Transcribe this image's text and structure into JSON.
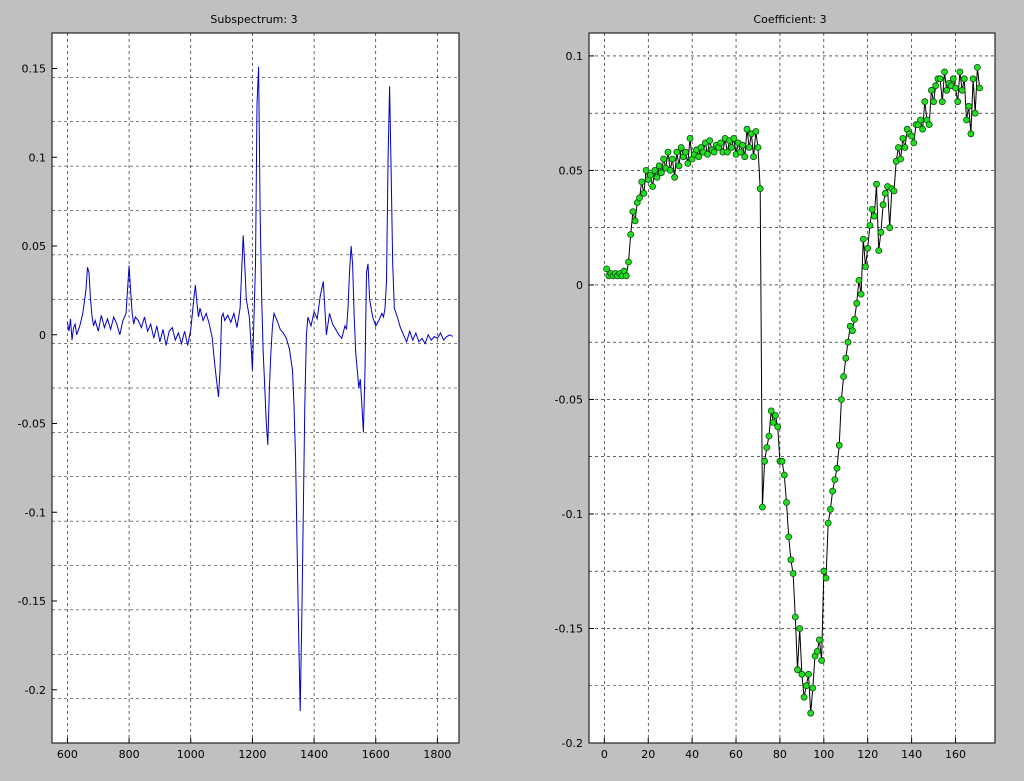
{
  "figure": {
    "background": "#c0c0c0"
  },
  "chart_data": [
    {
      "type": "line",
      "title": "Subspectrum: 3",
      "xlabel": "",
      "ylabel": "",
      "xlim": [
        550,
        1870
      ],
      "ylim": [
        -0.23,
        0.17
      ],
      "xticks": [
        600,
        800,
        1000,
        1200,
        1400,
        1600,
        1800
      ],
      "yticks": [
        -0.2,
        -0.15,
        -0.1,
        -0.05,
        0,
        0.05,
        0.1,
        0.15
      ],
      "xtick_labels": [
        "600",
        "800",
        "1000",
        "1200",
        "1400",
        "1600",
        "1800"
      ],
      "ytick_labels": [
        "-0.2",
        "-0.15",
        "-0.1",
        "-0.05",
        "0",
        "0.05",
        "0.1",
        "0.15"
      ],
      "grid": true,
      "line_color": "#0000c8",
      "series": [
        {
          "x": [
            600,
            605,
            610,
            615,
            620,
            625,
            630,
            640,
            650,
            660,
            665,
            670,
            675,
            680,
            685,
            690,
            700,
            710,
            720,
            730,
            740,
            750,
            760,
            770,
            780,
            790,
            795,
            800,
            805,
            810,
            815,
            820,
            830,
            840,
            850,
            860,
            870,
            880,
            890,
            900,
            910,
            920,
            930,
            940,
            950,
            960,
            970,
            980,
            990,
            1000,
            1010,
            1015,
            1020,
            1025,
            1030,
            1040,
            1050,
            1060,
            1070,
            1075,
            1080,
            1085,
            1090,
            1095,
            1100,
            1105,
            1110,
            1120,
            1130,
            1140,
            1150,
            1160,
            1165,
            1170,
            1175,
            1180,
            1185,
            1190,
            1195,
            1200,
            1205,
            1210,
            1215,
            1220,
            1225,
            1230,
            1235,
            1240,
            1245,
            1250,
            1255,
            1260,
            1265,
            1270,
            1275,
            1280,
            1290,
            1300,
            1310,
            1320,
            1330,
            1335,
            1340,
            1345,
            1350,
            1355,
            1360,
            1365,
            1370,
            1375,
            1380,
            1390,
            1400,
            1410,
            1420,
            1430,
            1440,
            1450,
            1460,
            1470,
            1480,
            1490,
            1500,
            1505,
            1510,
            1515,
            1520,
            1525,
            1530,
            1535,
            1540,
            1545,
            1550,
            1555,
            1560,
            1565,
            1570,
            1575,
            1580,
            1590,
            1600,
            1610,
            1620,
            1625,
            1630,
            1635,
            1640,
            1645,
            1650,
            1655,
            1660,
            1670,
            1680,
            1690,
            1700,
            1710,
            1720,
            1730,
            1740,
            1750,
            1760,
            1770,
            1780,
            1790,
            1800,
            1810,
            1820,
            1830,
            1840,
            1850
          ],
          "y": [
            0.007,
            0.002,
            0.009,
            -0.003,
            0.004,
            0.006,
            0.0,
            0.005,
            0.012,
            0.025,
            0.038,
            0.035,
            0.02,
            0.01,
            0.005,
            0.008,
            0.002,
            0.011,
            0.004,
            0.009,
            0.003,
            0.01,
            0.006,
            0.0,
            0.008,
            0.012,
            0.025,
            0.039,
            0.025,
            0.012,
            0.006,
            0.01,
            0.008,
            0.004,
            0.01,
            0.002,
            0.006,
            -0.002,
            0.005,
            -0.004,
            0.003,
            -0.006,
            0.002,
            0.004,
            -0.003,
            0.001,
            -0.005,
            0.002,
            -0.006,
            0.003,
            0.02,
            0.028,
            0.018,
            0.01,
            0.015,
            0.008,
            0.012,
            0.006,
            -0.002,
            -0.012,
            -0.02,
            -0.028,
            -0.035,
            -0.02,
            0.01,
            0.012,
            0.008,
            0.011,
            0.007,
            0.012,
            0.004,
            0.015,
            0.035,
            0.056,
            0.04,
            0.02,
            0.015,
            0.01,
            -0.004,
            -0.02,
            0.01,
            0.04,
            0.13,
            0.151,
            0.07,
            0.02,
            -0.01,
            -0.03,
            -0.05,
            -0.062,
            -0.03,
            -0.01,
            0.005,
            0.012,
            0.01,
            0.008,
            0.003,
            0.001,
            -0.002,
            -0.008,
            -0.02,
            -0.04,
            -0.07,
            -0.12,
            -0.17,
            -0.212,
            -0.16,
            -0.1,
            -0.04,
            0.0,
            0.01,
            0.005,
            0.013,
            0.009,
            0.022,
            0.03,
            0.0,
            0.012,
            0.006,
            0.003,
            0.0,
            -0.002,
            0.005,
            0.003,
            0.015,
            0.035,
            0.05,
            0.04,
            0.01,
            -0.01,
            -0.02,
            -0.03,
            -0.025,
            -0.04,
            -0.055,
            -0.02,
            0.035,
            0.04,
            0.02,
            0.01,
            0.005,
            0.008,
            0.012,
            0.01,
            0.015,
            0.03,
            0.1,
            0.14,
            0.09,
            0.04,
            0.015,
            0.01,
            0.004,
            0.0,
            -0.004,
            0.002,
            -0.003,
            0.001,
            -0.004,
            -0.002,
            -0.005,
            0.0,
            -0.003,
            -0.001,
            -0.002,
            0.001,
            -0.003,
            -0.001,
            0.0,
            -0.001
          ]
        }
      ]
    },
    {
      "type": "line",
      "title": "Coefficient: 3",
      "xlabel": "",
      "ylabel": "",
      "xlim": [
        -7,
        178
      ],
      "ylim": [
        -0.2,
        0.11
      ],
      "xticks": [
        0,
        20,
        40,
        60,
        80,
        100,
        120,
        140,
        160
      ],
      "yticks": [
        -0.2,
        -0.15,
        -0.1,
        -0.05,
        0,
        0.05,
        0.1
      ],
      "xtick_labels": [
        "0",
        "20",
        "40",
        "60",
        "80",
        "100",
        "120",
        "140",
        "160"
      ],
      "ytick_labels": [
        "-0.2",
        "-0.15",
        "-0.1",
        "-0.05",
        "0",
        "0.05",
        "0.1"
      ],
      "grid": true,
      "line_color": "#000000",
      "marker_fill": "#22dd22",
      "marker_edge": "#0a500a",
      "series": [
        {
          "x": [
            1,
            2,
            3,
            4,
            5,
            6,
            7,
            8,
            9,
            10,
            11,
            12,
            13,
            14,
            15,
            16,
            17,
            18,
            19,
            20,
            21,
            22,
            23,
            24,
            25,
            26,
            27,
            28,
            29,
            30,
            31,
            32,
            33,
            34,
            35,
            36,
            37,
            38,
            39,
            40,
            41,
            42,
            43,
            44,
            45,
            46,
            47,
            48,
            49,
            50,
            51,
            52,
            53,
            54,
            55,
            56,
            57,
            58,
            59,
            60,
            61,
            62,
            63,
            64,
            65,
            66,
            67,
            68,
            69,
            70,
            71,
            72,
            73,
            74,
            75,
            76,
            77,
            78,
            79,
            80,
            81,
            82,
            83,
            84,
            85,
            86,
            87,
            88,
            89,
            90,
            91,
            92,
            93,
            94,
            95,
            96,
            97,
            98,
            99,
            100,
            101,
            102,
            103,
            104,
            105,
            106,
            107,
            108,
            109,
            110,
            111,
            112,
            113,
            114,
            115,
            116,
            117,
            118,
            119,
            120,
            121,
            122,
            123,
            124,
            125,
            126,
            127,
            128,
            129,
            130,
            131,
            132,
            133,
            134,
            135,
            136,
            137,
            138,
            139,
            140,
            141,
            142,
            143,
            144,
            145,
            146,
            147,
            148,
            149,
            150,
            151,
            152,
            153,
            154,
            155,
            156,
            157,
            158,
            159,
            160,
            161,
            162,
            163,
            164,
            165,
            166,
            167,
            168,
            169,
            170,
            171
          ],
          "y": [
            0.007,
            0.004,
            0.005,
            0.004,
            0.005,
            0.004,
            0.005,
            0.004,
            0.006,
            0.004,
            0.01,
            0.022,
            0.032,
            0.028,
            0.036,
            0.038,
            0.045,
            0.04,
            0.05,
            0.046,
            0.048,
            0.043,
            0.05,
            0.047,
            0.052,
            0.049,
            0.055,
            0.051,
            0.058,
            0.05,
            0.055,
            0.047,
            0.058,
            0.052,
            0.06,
            0.056,
            0.058,
            0.053,
            0.064,
            0.055,
            0.057,
            0.059,
            0.056,
            0.06,
            0.058,
            0.062,
            0.057,
            0.063,
            0.059,
            0.058,
            0.061,
            0.06,
            0.062,
            0.058,
            0.064,
            0.058,
            0.063,
            0.06,
            0.064,
            0.057,
            0.062,
            0.058,
            0.061,
            0.056,
            0.068,
            0.06,
            0.066,
            0.056,
            0.067,
            0.06,
            0.042,
            -0.097,
            -0.077,
            -0.071,
            -0.066,
            -0.055,
            -0.06,
            -0.057,
            -0.062,
            -0.077,
            -0.077,
            -0.083,
            -0.095,
            -0.11,
            -0.12,
            -0.126,
            -0.145,
            -0.168,
            -0.15,
            -0.17,
            -0.18,
            -0.175,
            -0.17,
            -0.187,
            -0.176,
            -0.162,
            -0.16,
            -0.155,
            -0.164,
            -0.125,
            -0.128,
            -0.104,
            -0.098,
            -0.09,
            -0.085,
            -0.08,
            -0.07,
            -0.05,
            -0.04,
            -0.032,
            -0.025,
            -0.018,
            -0.02,
            -0.015,
            -0.008,
            0.002,
            -0.004,
            0.02,
            0.008,
            0.016,
            0.026,
            0.033,
            0.03,
            0.044,
            0.015,
            0.023,
            0.035,
            0.04,
            0.043,
            0.025,
            0.042,
            0.041,
            0.054,
            0.06,
            0.055,
            0.064,
            0.06,
            0.068,
            0.066,
            0.065,
            0.062,
            0.07,
            0.07,
            0.072,
            0.068,
            0.08,
            0.072,
            0.07,
            0.085,
            0.08,
            0.087,
            0.09,
            0.09,
            0.08,
            0.093,
            0.085,
            0.088,
            0.087,
            0.09,
            0.086,
            0.08,
            0.093,
            0.085,
            0.09,
            0.072,
            0.078,
            0.066,
            0.09,
            0.075,
            0.095,
            0.086
          ]
        }
      ]
    }
  ]
}
